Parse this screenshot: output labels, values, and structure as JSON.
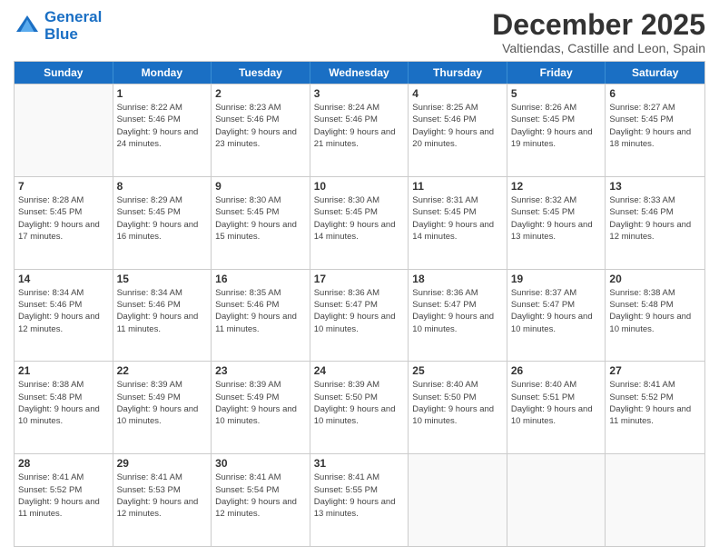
{
  "logo": {
    "line1": "General",
    "line2": "Blue"
  },
  "title": "December 2025",
  "subtitle": "Valtiendas, Castille and Leon, Spain",
  "header_days": [
    "Sunday",
    "Monday",
    "Tuesday",
    "Wednesday",
    "Thursday",
    "Friday",
    "Saturday"
  ],
  "rows": [
    [
      {
        "day": "",
        "sunrise": "",
        "sunset": "",
        "daylight": "",
        "empty": true
      },
      {
        "day": "1",
        "sunrise": "Sunrise: 8:22 AM",
        "sunset": "Sunset: 5:46 PM",
        "daylight": "Daylight: 9 hours and 24 minutes."
      },
      {
        "day": "2",
        "sunrise": "Sunrise: 8:23 AM",
        "sunset": "Sunset: 5:46 PM",
        "daylight": "Daylight: 9 hours and 23 minutes."
      },
      {
        "day": "3",
        "sunrise": "Sunrise: 8:24 AM",
        "sunset": "Sunset: 5:46 PM",
        "daylight": "Daylight: 9 hours and 21 minutes."
      },
      {
        "day": "4",
        "sunrise": "Sunrise: 8:25 AM",
        "sunset": "Sunset: 5:46 PM",
        "daylight": "Daylight: 9 hours and 20 minutes."
      },
      {
        "day": "5",
        "sunrise": "Sunrise: 8:26 AM",
        "sunset": "Sunset: 5:45 PM",
        "daylight": "Daylight: 9 hours and 19 minutes."
      },
      {
        "day": "6",
        "sunrise": "Sunrise: 8:27 AM",
        "sunset": "Sunset: 5:45 PM",
        "daylight": "Daylight: 9 hours and 18 minutes."
      }
    ],
    [
      {
        "day": "7",
        "sunrise": "Sunrise: 8:28 AM",
        "sunset": "Sunset: 5:45 PM",
        "daylight": "Daylight: 9 hours and 17 minutes."
      },
      {
        "day": "8",
        "sunrise": "Sunrise: 8:29 AM",
        "sunset": "Sunset: 5:45 PM",
        "daylight": "Daylight: 9 hours and 16 minutes."
      },
      {
        "day": "9",
        "sunrise": "Sunrise: 8:30 AM",
        "sunset": "Sunset: 5:45 PM",
        "daylight": "Daylight: 9 hours and 15 minutes."
      },
      {
        "day": "10",
        "sunrise": "Sunrise: 8:30 AM",
        "sunset": "Sunset: 5:45 PM",
        "daylight": "Daylight: 9 hours and 14 minutes."
      },
      {
        "day": "11",
        "sunrise": "Sunrise: 8:31 AM",
        "sunset": "Sunset: 5:45 PM",
        "daylight": "Daylight: 9 hours and 14 minutes."
      },
      {
        "day": "12",
        "sunrise": "Sunrise: 8:32 AM",
        "sunset": "Sunset: 5:45 PM",
        "daylight": "Daylight: 9 hours and 13 minutes."
      },
      {
        "day": "13",
        "sunrise": "Sunrise: 8:33 AM",
        "sunset": "Sunset: 5:46 PM",
        "daylight": "Daylight: 9 hours and 12 minutes."
      }
    ],
    [
      {
        "day": "14",
        "sunrise": "Sunrise: 8:34 AM",
        "sunset": "Sunset: 5:46 PM",
        "daylight": "Daylight: 9 hours and 12 minutes."
      },
      {
        "day": "15",
        "sunrise": "Sunrise: 8:34 AM",
        "sunset": "Sunset: 5:46 PM",
        "daylight": "Daylight: 9 hours and 11 minutes."
      },
      {
        "day": "16",
        "sunrise": "Sunrise: 8:35 AM",
        "sunset": "Sunset: 5:46 PM",
        "daylight": "Daylight: 9 hours and 11 minutes."
      },
      {
        "day": "17",
        "sunrise": "Sunrise: 8:36 AM",
        "sunset": "Sunset: 5:47 PM",
        "daylight": "Daylight: 9 hours and 10 minutes."
      },
      {
        "day": "18",
        "sunrise": "Sunrise: 8:36 AM",
        "sunset": "Sunset: 5:47 PM",
        "daylight": "Daylight: 9 hours and 10 minutes."
      },
      {
        "day": "19",
        "sunrise": "Sunrise: 8:37 AM",
        "sunset": "Sunset: 5:47 PM",
        "daylight": "Daylight: 9 hours and 10 minutes."
      },
      {
        "day": "20",
        "sunrise": "Sunrise: 8:38 AM",
        "sunset": "Sunset: 5:48 PM",
        "daylight": "Daylight: 9 hours and 10 minutes."
      }
    ],
    [
      {
        "day": "21",
        "sunrise": "Sunrise: 8:38 AM",
        "sunset": "Sunset: 5:48 PM",
        "daylight": "Daylight: 9 hours and 10 minutes."
      },
      {
        "day": "22",
        "sunrise": "Sunrise: 8:39 AM",
        "sunset": "Sunset: 5:49 PM",
        "daylight": "Daylight: 9 hours and 10 minutes."
      },
      {
        "day": "23",
        "sunrise": "Sunrise: 8:39 AM",
        "sunset": "Sunset: 5:49 PM",
        "daylight": "Daylight: 9 hours and 10 minutes."
      },
      {
        "day": "24",
        "sunrise": "Sunrise: 8:39 AM",
        "sunset": "Sunset: 5:50 PM",
        "daylight": "Daylight: 9 hours and 10 minutes."
      },
      {
        "day": "25",
        "sunrise": "Sunrise: 8:40 AM",
        "sunset": "Sunset: 5:50 PM",
        "daylight": "Daylight: 9 hours and 10 minutes."
      },
      {
        "day": "26",
        "sunrise": "Sunrise: 8:40 AM",
        "sunset": "Sunset: 5:51 PM",
        "daylight": "Daylight: 9 hours and 10 minutes."
      },
      {
        "day": "27",
        "sunrise": "Sunrise: 8:41 AM",
        "sunset": "Sunset: 5:52 PM",
        "daylight": "Daylight: 9 hours and 11 minutes."
      }
    ],
    [
      {
        "day": "28",
        "sunrise": "Sunrise: 8:41 AM",
        "sunset": "Sunset: 5:52 PM",
        "daylight": "Daylight: 9 hours and 11 minutes."
      },
      {
        "day": "29",
        "sunrise": "Sunrise: 8:41 AM",
        "sunset": "Sunset: 5:53 PM",
        "daylight": "Daylight: 9 hours and 12 minutes."
      },
      {
        "day": "30",
        "sunrise": "Sunrise: 8:41 AM",
        "sunset": "Sunset: 5:54 PM",
        "daylight": "Daylight: 9 hours and 12 minutes."
      },
      {
        "day": "31",
        "sunrise": "Sunrise: 8:41 AM",
        "sunset": "Sunset: 5:55 PM",
        "daylight": "Daylight: 9 hours and 13 minutes."
      },
      {
        "day": "",
        "sunrise": "",
        "sunset": "",
        "daylight": "",
        "empty": true
      },
      {
        "day": "",
        "sunrise": "",
        "sunset": "",
        "daylight": "",
        "empty": true
      },
      {
        "day": "",
        "sunrise": "",
        "sunset": "",
        "daylight": "",
        "empty": true
      }
    ]
  ]
}
